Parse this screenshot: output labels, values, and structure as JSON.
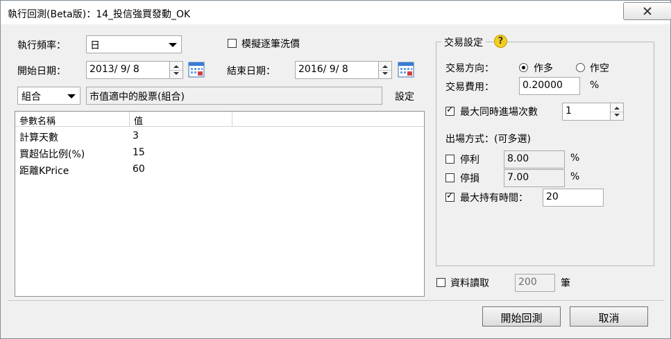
{
  "window": {
    "title": "執行回測(Beta版)：14_投信強買發動_OK"
  },
  "left": {
    "freq_label": "執行頻率：",
    "freq_value": "日",
    "simulate_label": "模擬逐筆洗價",
    "simulate_checked": false,
    "start_label": "開始日期：",
    "start_value": "2013/ 9/ 8",
    "end_label": "結束日期：",
    "end_value": "2016/ 9/ 8",
    "universe_type": "組合",
    "universe_value": "市值適中的股票(組合)",
    "settings_link": "設定",
    "table": {
      "headers": [
        "參數名稱",
        "值"
      ],
      "rows": [
        [
          "計算天數",
          "3"
        ],
        [
          "買超佔比例(%)",
          "15"
        ],
        [
          "距離KPrice",
          "60"
        ]
      ]
    }
  },
  "trade": {
    "title": "交易設定",
    "help_glyph": "?",
    "direction_label": "交易方向：",
    "long_label": "作多",
    "short_label": "作空",
    "direction_value": "作多",
    "fee_label": "交易費用：",
    "fee_value": "0.20000",
    "fee_unit": "%",
    "max_entries_label": "最大同時進場次數",
    "max_entries_checked": true,
    "max_entries_value": "1",
    "exit_label": "出場方式：(可多選)",
    "take_profit_label": "停利",
    "take_profit_checked": false,
    "take_profit_value": "8.00",
    "take_profit_unit": "%",
    "stop_loss_label": "停損",
    "stop_loss_checked": false,
    "stop_loss_value": "7.00",
    "stop_loss_unit": "%",
    "max_hold_label": "最大持有時間：",
    "max_hold_checked": true,
    "max_hold_value": "20"
  },
  "data_read": {
    "label": "資料讀取",
    "checked": false,
    "value": "200",
    "unit": "筆"
  },
  "buttons": {
    "start": "開始回測",
    "cancel": "取消"
  }
}
